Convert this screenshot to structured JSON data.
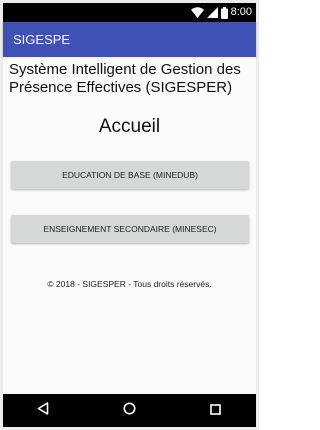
{
  "status_bar": {
    "time": "8:00",
    "icons": [
      "wifi-icon",
      "cellular-signal-icon",
      "battery-icon"
    ]
  },
  "app_bar": {
    "title": "SIGESPE",
    "color": "#3f51b5"
  },
  "main": {
    "system_title": "Système Intelligent de Gestion des Présence Effectives (SIGESPER)",
    "heading": "Accueil",
    "buttons": [
      {
        "label": "EDUCATION DE BASE (MINEDUB)"
      },
      {
        "label": "ENSEIGNEMENT SECONDAIRE (MINESEC)"
      }
    ],
    "copyright": "© 2018 - SIGESPER - Tous droits réservés."
  },
  "nav_bar": {
    "icons": [
      "back-icon",
      "home-icon",
      "recent-apps-icon"
    ]
  }
}
